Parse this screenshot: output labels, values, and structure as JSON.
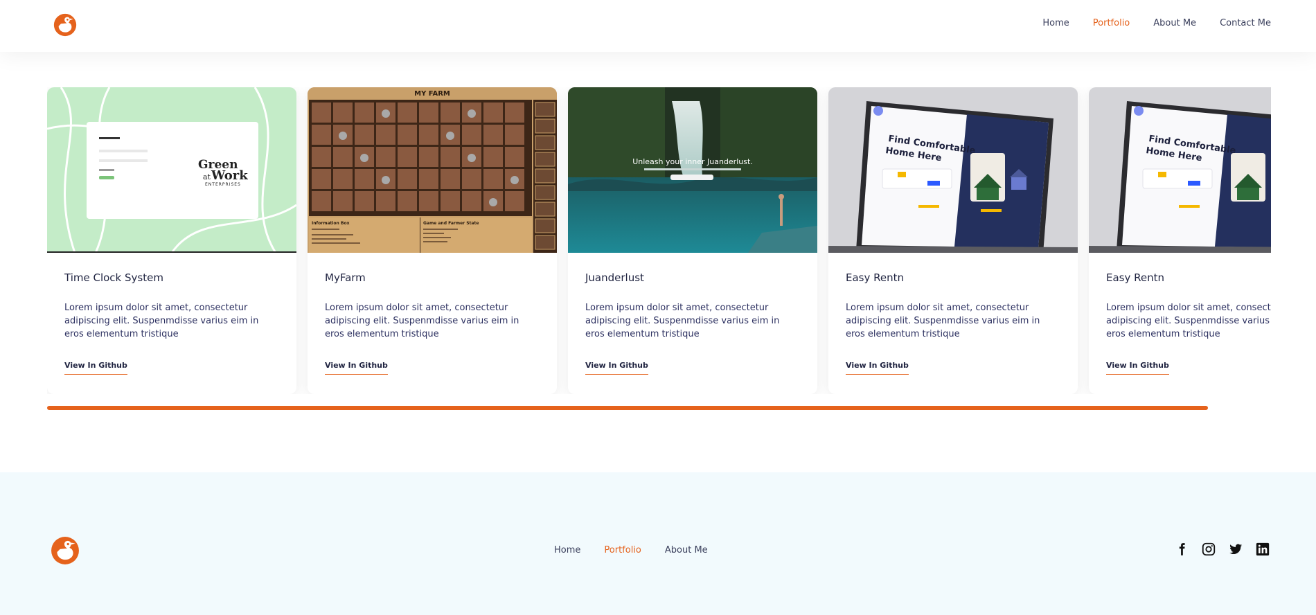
{
  "header": {
    "logo": "duck-logo",
    "nav": [
      {
        "label": "Home",
        "active": false
      },
      {
        "label": "Portfolio",
        "active": true
      },
      {
        "label": "About Me",
        "active": false
      },
      {
        "label": "Contact Me",
        "active": false
      }
    ]
  },
  "projects": [
    {
      "title": "Time Clock System",
      "description": "Lorem ipsum dolor sit amet, consectetur adipiscing elit. Suspenmdisse varius eim in eros elementum tristique",
      "link": "View In Github"
    },
    {
      "title": "MyFarm",
      "description": "Lorem ipsum dolor sit amet, consectetur adipiscing elit. Suspenmdisse varius eim in eros elementum tristique",
      "link": "View In Github"
    },
    {
      "title": "Juanderlust",
      "description": "Lorem ipsum dolor sit amet, consectetur adipiscing elit. Suspenmdisse varius eim in eros elementum tristique",
      "link": "View In Github"
    },
    {
      "title": "Easy Rentn",
      "description": "Lorem ipsum dolor sit amet, consectetur adipiscing elit. Suspenmdisse varius eim in eros elementum tristique",
      "link": "View In Github"
    },
    {
      "title": "Easy Rentn",
      "description": "Lorem ipsum dolor sit amet, consectetur adipiscing elit. Suspenmdisse varius eim in eros elementum tristique",
      "link": "View In Github"
    }
  ],
  "thumbnails": {
    "green_logo_1": "Green",
    "green_logo_at": "at",
    "green_logo_2": "Work",
    "green_logo_3": "ENTERPRISES",
    "farm_title": "MY FARM",
    "farm_info": "Information Box",
    "farm_state": "Game and Farmer State",
    "juan_heading": "Unleash your inner Juanderlust.",
    "rent_heading_1": "Find Comfortable",
    "rent_heading_2": "Home Here"
  },
  "footer": {
    "nav": [
      {
        "label": "Home",
        "active": false
      },
      {
        "label": "Portfolio",
        "active": true
      },
      {
        "label": "About Me",
        "active": false
      }
    ],
    "social": [
      "facebook-icon",
      "instagram-icon",
      "twitter-icon",
      "linkedin-icon"
    ]
  },
  "colors": {
    "accent": "#e5621c",
    "text": "#1f2340",
    "footer_bg": "#f2fafd"
  }
}
